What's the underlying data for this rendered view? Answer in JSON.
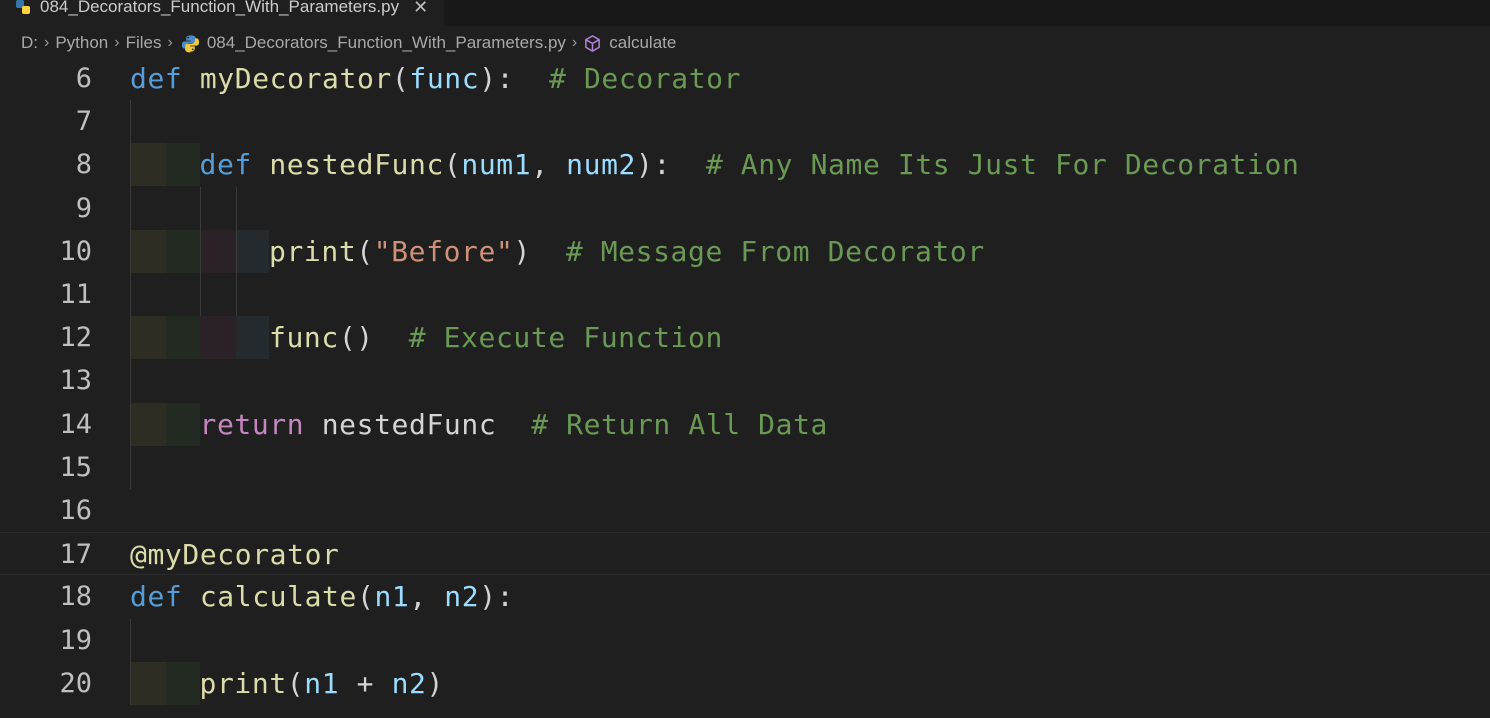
{
  "tab": {
    "filename": "084_Decorators_Function_With_Parameters.py",
    "close_glyph": "✕",
    "icon": "python-icon"
  },
  "breadcrumb": {
    "items": [
      "D:",
      "Python",
      "Files",
      "084_Decorators_Function_With_Parameters.py",
      "calculate"
    ],
    "separator": "›",
    "symbol_icon": "function-symbol-icon"
  },
  "editor": {
    "current_line": 17,
    "lines": [
      {
        "number": "6",
        "tokens": [
          [
            "k",
            "def"
          ],
          [
            "t",
            " "
          ],
          [
            "fn",
            "myDecorator"
          ],
          [
            "t",
            "("
          ],
          [
            "p",
            "func"
          ],
          [
            "t",
            "):  "
          ],
          [
            "c",
            "# Decorator"
          ]
        ],
        "indent": 0
      },
      {
        "number": "7",
        "tokens": [],
        "indent": 0
      },
      {
        "number": "8",
        "tokens": [
          [
            "k",
            "def"
          ],
          [
            "t",
            " "
          ],
          [
            "fn",
            "nestedFunc"
          ],
          [
            "t",
            "("
          ],
          [
            "p",
            "num1"
          ],
          [
            "t",
            ", "
          ],
          [
            "p",
            "num2"
          ],
          [
            "t",
            "):  "
          ],
          [
            "c",
            "# Any Name Its Just For Decoration"
          ]
        ],
        "indent": 1
      },
      {
        "number": "9",
        "tokens": [],
        "indent": 0
      },
      {
        "number": "10",
        "tokens": [
          [
            "fn",
            "print"
          ],
          [
            "t",
            "("
          ],
          [
            "s",
            "\"Before\""
          ],
          [
            "t",
            ")  "
          ],
          [
            "c",
            "# Message From Decorator"
          ]
        ],
        "indent": 2
      },
      {
        "number": "11",
        "tokens": [],
        "indent": 0
      },
      {
        "number": "12",
        "tokens": [
          [
            "fn",
            "func"
          ],
          [
            "t",
            "()  "
          ],
          [
            "c",
            "# Execute Function"
          ]
        ],
        "indent": 2
      },
      {
        "number": "13",
        "tokens": [],
        "indent": 0
      },
      {
        "number": "14",
        "tokens": [
          [
            "r",
            "return"
          ],
          [
            "t",
            " "
          ],
          [
            "t",
            "nestedFunc  "
          ],
          [
            "c",
            "# Return All Data"
          ]
        ],
        "indent": 1
      },
      {
        "number": "15",
        "tokens": [],
        "indent": 0
      },
      {
        "number": "16",
        "tokens": [],
        "indent": 0
      },
      {
        "number": "17",
        "tokens": [
          [
            "d",
            "@myDecorator"
          ]
        ],
        "indent": 0
      },
      {
        "number": "18",
        "tokens": [
          [
            "k",
            "def"
          ],
          [
            "t",
            " "
          ],
          [
            "fn",
            "calculate"
          ],
          [
            "t",
            "("
          ],
          [
            "p",
            "n1"
          ],
          [
            "t",
            ", "
          ],
          [
            "p",
            "n2"
          ],
          [
            "t",
            "):"
          ]
        ],
        "indent": 0
      },
      {
        "number": "19",
        "tokens": [],
        "indent": 0
      },
      {
        "number": "20",
        "tokens": [
          [
            "fn",
            "print"
          ],
          [
            "t",
            "("
          ],
          [
            "p",
            "n1"
          ],
          [
            "t",
            " + "
          ],
          [
            "p",
            "n2"
          ],
          [
            "t",
            ")"
          ]
        ],
        "indent": 1
      }
    ]
  },
  "colors": {
    "keyword": "#569cd6",
    "function": "#dcdcaa",
    "parameter": "#9cdcfe",
    "string": "#ce9178",
    "comment": "#6a9955",
    "control": "#c586c0",
    "background": "#1f1f1f"
  }
}
